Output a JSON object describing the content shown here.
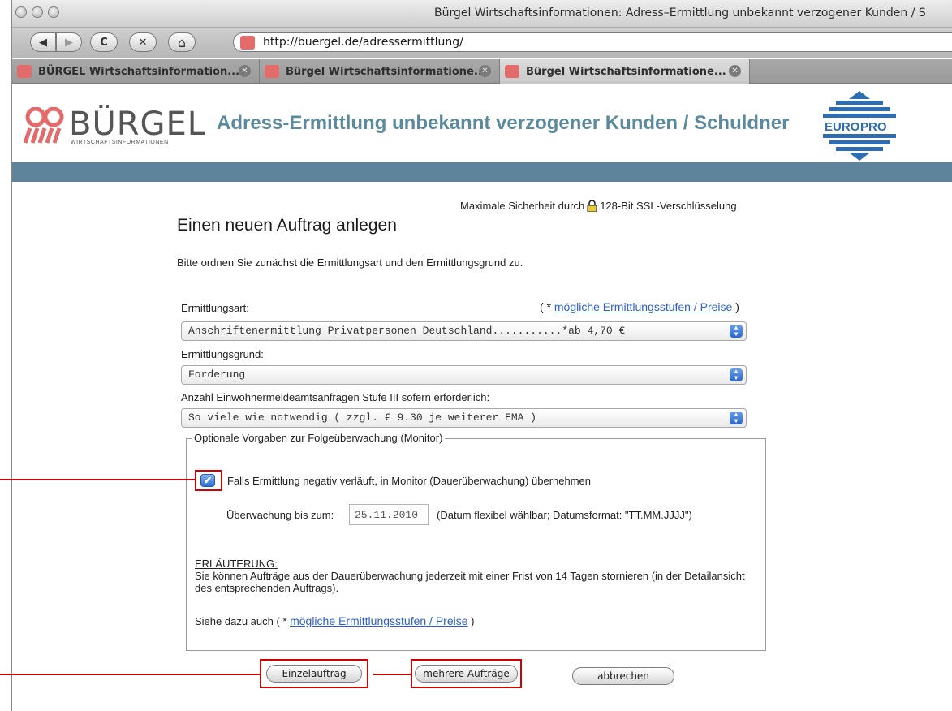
{
  "window": {
    "title": "Bürgel Wirtschaftsinformationen: Adress–Ermittlung unbekannt verzogener Kunden / S"
  },
  "toolbar": {
    "back_glyph": "◀",
    "forward_glyph": "▶",
    "reload_glyph": "C",
    "stop_glyph": "✕",
    "home_glyph": "⌂",
    "url": "http://buergel.de/adressermittlung/"
  },
  "tabs": [
    {
      "label": "BÜRGEL Wirtschaftsinformation...",
      "active": false
    },
    {
      "label": "Bürgel Wirtschaftsinformatione...",
      "active": false
    },
    {
      "label": "Bürgel Wirtschaftsinformatione...",
      "active": true
    }
  ],
  "header": {
    "logo_text": "BÜRGEL",
    "logo_subtitle": "WIRTSCHAFTSINFORMATIONEN",
    "title": "Adress-Ermittlung unbekannt verzogener Kunden / Schuldner",
    "partner_logo_text_1": "EURO",
    "partner_logo_text_2": "PRO"
  },
  "colors": {
    "brand_red": "#e36b6b",
    "header_blue": "#5b8a9d",
    "bar_blue": "#5d849a",
    "link_blue": "#2b5fcf",
    "annotation_red": "#d20000"
  },
  "main": {
    "ssl_prefix": "Maximale Sicherheit durch",
    "ssl_suffix": "128-Bit SSL-Verschlüsselung",
    "page_title": "Einen neuen Auftrag anlegen",
    "intro": "Bitte ordnen Sie zunächst die Ermittlungsart und den Ermittlungsgrund zu.",
    "art_label": "Ermittlungsart:",
    "price_prefix": "( * ",
    "price_link": "mögliche Ermittlungsstufen / Preise",
    "price_suffix": " )",
    "art_value": "Anschriftenermittlung Privatpersonen Deutschland...........*ab 4,70 €",
    "grund_label": "Ermittlungsgrund:",
    "grund_value": "Forderung",
    "anzahl_label": "Anzahl Einwohnermeldeamtsanfragen Stufe III sofern erforderlich:",
    "anzahl_value": "So viele wie notwendig ( zzgl. € 9.30 je weiterer EMA )"
  },
  "monitor": {
    "legend": "Optionale Vorgaben zur Folgeüberwachung (Monitor)",
    "checkbox_checked": true,
    "checkbox_label": "Falls Ermittlung negativ verläuft, in Monitor (Dauerüberwachung) übernehmen",
    "until_label": "Überwachung bis zum:",
    "until_value": "25.11.2010",
    "date_hint": "(Datum flexibel wählbar; Datumsformat: \"TT.MM.JJJJ\")",
    "note_head": "ERLÄUTERUNG:",
    "note_body": "Sie können Aufträge aus der Dauerüberwachung jederzeit mit einer Frist von 14 Tagen stornieren (in der Detailansicht des entsprechenden Auftrags).",
    "see_also_prefix": "Siehe dazu auch ( * ",
    "see_also_link": "mögliche Ermittlungsstufen / Preise",
    "see_also_suffix": " )"
  },
  "buttons": {
    "single": "Einzelauftrag",
    "multiple": "mehrere Aufträge",
    "cancel": "abbrechen"
  }
}
